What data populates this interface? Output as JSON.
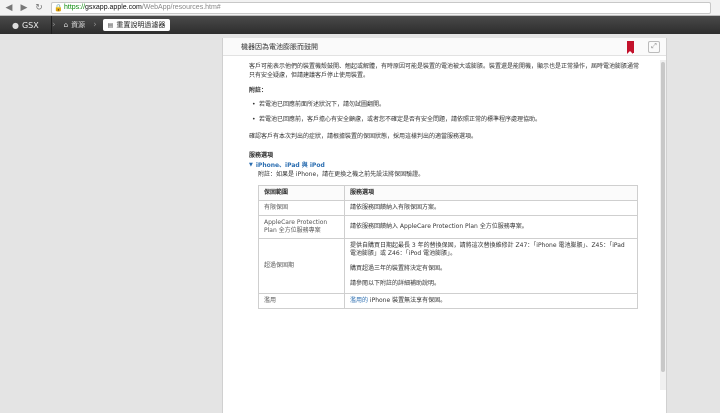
{
  "browser": {
    "url_scheme": "https://",
    "url_host": "gsxapp.apple.com",
    "url_path": "/WebApp/resources.htm#"
  },
  "topnav": {
    "brand": "GSX",
    "home_label": "資源",
    "current_label": "重置說明過濾器"
  },
  "panel": {
    "title": "機器因為電池膨脹而鼓開",
    "intro": "客戶可能表示他們的裝置機殼鼓開、翹起或解體，有時原因可能是裝置的電池被大或膨脹。裝置還是能開機，顯示也是正常操作，屆時電池膨脹通常只有安全疑慮，但請建議客戶停止使用裝置。",
    "note_heading": "附註：",
    "notes": [
      "若電池已回應前面所述狀況下，請勿試圖翻開。",
      "若電池已回應前，客戶擔心有安全顧慮，或者您不確定是否有安全問題，請依照正常的標準程序處理協助。"
    ],
    "determine": "確認客戶有本次判出的症狀，請根據裝置的保固狀態，採用這樣判出的適當服務選項。",
    "service_heading": "服務選項",
    "product_title": "iPhone、iPad 與 iPod",
    "product_note": "附註：如果是 iPhone，請在更換之機之前先設法將保固驗證。",
    "table": {
      "headers": [
        "保固範圍",
        "服務選項"
      ],
      "rows": [
        {
          "coverage": "有限保固",
          "options": [
            "請依服務回饋納入有限保固方案。"
          ]
        },
        {
          "coverage": "AppleCare Protection Plan 全方位服務專案",
          "options": [
            "請依服務回饋納入 AppleCare Protection Plan 全方位服務專案。"
          ]
        },
        {
          "coverage": "超過保固期",
          "options": [
            "提供自購買日期起最長 3 年的替換保固，請將這次替換維修計 Z47：「iPhone 電池膨脹」、Z45：「iPad 電池膨脹」或 Z46：「iPod 電池膨脹」。",
            "購買超過三年的裝置將決定有保固。",
            "請參閱以下附註的詳細補助說明。"
          ]
        },
        {
          "coverage": "濫用",
          "options_link": "濫用的",
          "options_rest": " iPhone 裝置無法享有保固。"
        }
      ]
    }
  }
}
